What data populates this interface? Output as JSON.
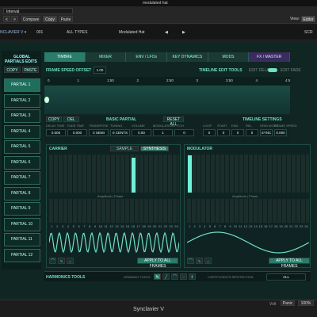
{
  "window": {
    "title": "modulated hat"
  },
  "topbar": {
    "search": "Interval",
    "nav_back": "<",
    "nav_fwd": ">",
    "compare": "Compare",
    "copy": "Copy",
    "paste": "Paste",
    "view_label": "View:",
    "view_value": "Editor"
  },
  "preset_bar": {
    "plugin": "NCLAVIER V ▾",
    "bank": "001",
    "category": "ALL TYPES",
    "patch": "Modulated Hat",
    "prev": "◀",
    "next": "▶",
    "right": "SCR"
  },
  "sidebar": {
    "title_line1": "GLOBAL",
    "title_line2": "PARTIALS EDITS",
    "copy": "COPY",
    "paste": "PASTE",
    "partials": [
      "PARTIAL 1",
      "PARTIAL 2",
      "PARTIAL 3",
      "PARTIAL 4",
      "PARTIAL 5",
      "PARTIAL 6",
      "PARTIAL 7",
      "PARTIAL 8",
      "PARTIAL 9",
      "PARTIAL 10",
      "PARTIAL 11",
      "PARTIAL 12"
    ],
    "selected": 0
  },
  "tabs": [
    "TIMBRE",
    "MIXER",
    "ENV / LFOs",
    "KEY DYNAMICS",
    "MODS",
    "FX / MASTER"
  ],
  "timeline": {
    "speed_label": "FRAME SPEED OFFSET",
    "speed_value": "1.00",
    "tools_label": "TIMELINE EDIT TOOLS",
    "edit_delay": "EDIT DELAY",
    "edit_fade": "EDIT FADE",
    "ruler": [
      "0",
      "1",
      "1:50",
      "2",
      "2:50",
      "3",
      "3:50",
      "4",
      "4:5"
    ]
  },
  "partial_panel": {
    "copy": "COPY",
    "paste": "DEL",
    "basic": "BASIC PARTIAL",
    "reset": "RESET ALL",
    "timeline_settings": "TIMELINE SETTINGS",
    "params": [
      {
        "label": "DELAY TIME",
        "value": "0.000"
      },
      {
        "label": "FADE TIME",
        "value": "0.000"
      },
      {
        "label": "TRANSPOSE",
        "value": "0 SEMI"
      },
      {
        "label": "TUNING",
        "value": "0 CENTS"
      },
      {
        "label": "VOLUME",
        "value": "0.00"
      },
      {
        "label": "MODULATION",
        "value": "1"
      },
      {
        "label": "PITCH",
        "value": "0"
      }
    ],
    "ts_params": [
      {
        "label": "LOOP",
        "value": "0"
      },
      {
        "label": "START",
        "value": "0"
      },
      {
        "label": "END",
        "value": "0"
      },
      {
        "label": "REL",
        "value": "0"
      },
      {
        "label": "GRID MODE",
        "value": "SYNC"
      },
      {
        "label": "FRAME SPEED",
        "value": "0.000"
      }
    ]
  },
  "carrier": {
    "title": "CARRIER",
    "tab_sample": "SAMPLE",
    "tab_synthesis": "SYNTHESIS",
    "caption": "Amplitude  |  Phase",
    "apply": "APPLY TO ALL FRAMES",
    "harmonics": [
      "1",
      "2",
      "3",
      "4",
      "5",
      "6",
      "7",
      "8",
      "9",
      "10",
      "11",
      "12",
      "13",
      "14",
      "15",
      "16",
      "17",
      "18",
      "19",
      "20",
      "21",
      "22",
      "23",
      "24"
    ],
    "active_harmonic": 16
  },
  "modulator": {
    "title": "MODULATOR",
    "caption": "Amplitude  |  Phase",
    "apply": "APPLY TO ALL FRAMES",
    "harmonics": [
      "1",
      "2",
      "3",
      "4",
      "5",
      "6",
      "7",
      "8",
      "9",
      "10",
      "11",
      "12",
      "13",
      "14",
      "15",
      "16",
      "17",
      "18",
      "19",
      "20",
      "21",
      "22",
      "23",
      "24"
    ],
    "active_harmonic": 1
  },
  "harmonics_tools": {
    "title": "HARMONICS TOOLS",
    "drawing": "DRAWING TOOLS",
    "coeff": "COEFFICIENTS RESTRICTION",
    "coeff_value": "ALL"
  },
  "footer": {
    "brand": "Synclavier V",
    "right_a": "Volt",
    "right_b": "Panic",
    "right_c": "100%"
  },
  "colors": {
    "accent": "#2a7d6a",
    "fx": "#3a2c5e",
    "active_bar": "#6ff0d8"
  }
}
